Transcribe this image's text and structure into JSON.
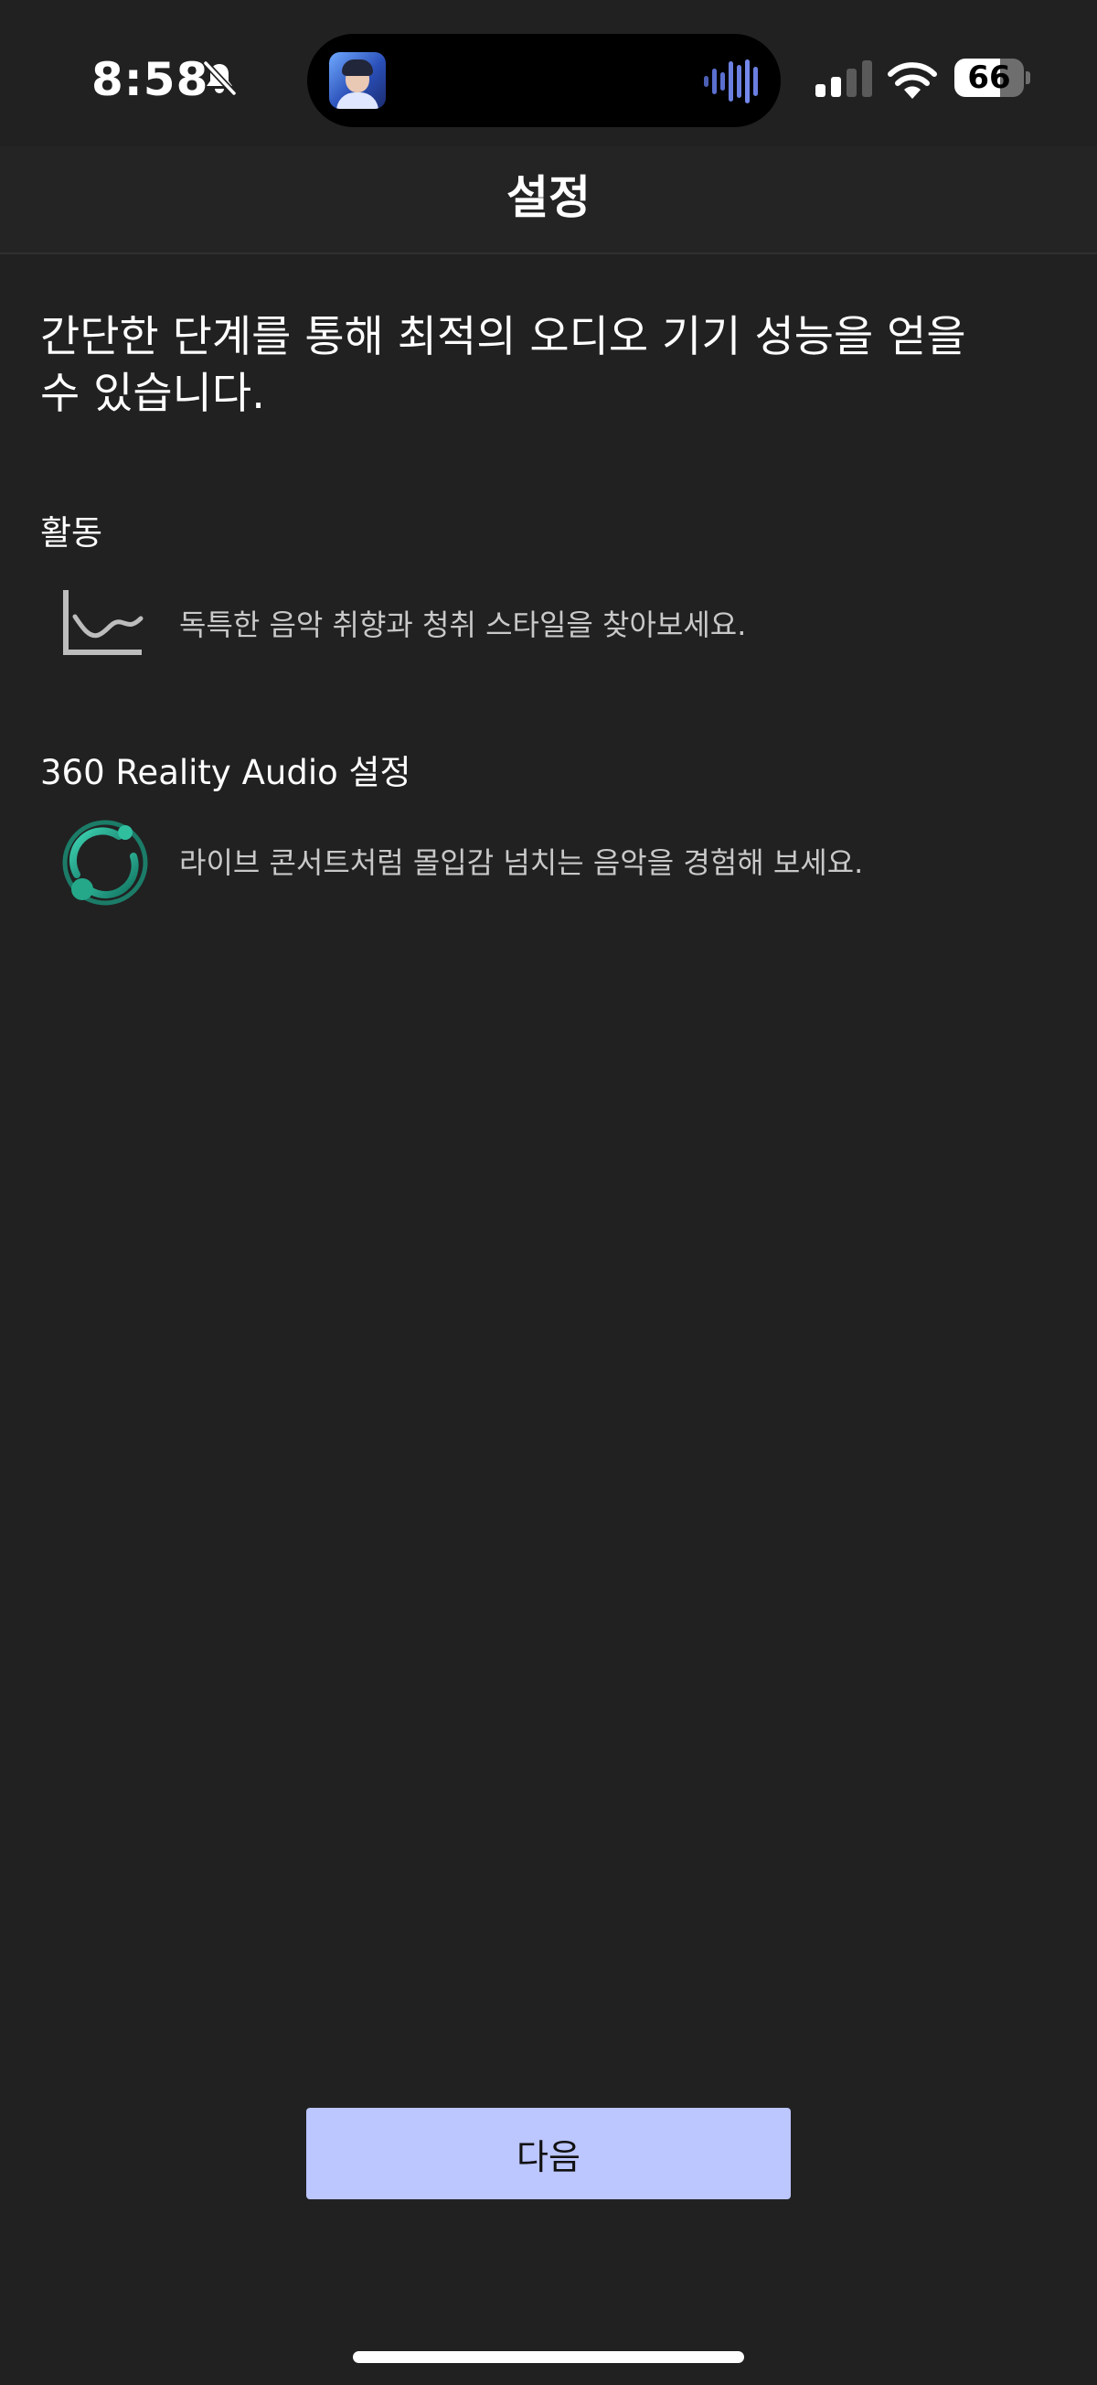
{
  "status_bar": {
    "time": "8:58",
    "battery_level": "66",
    "icons": [
      "bell-slash-icon",
      "app-thumbnail-icon",
      "audio-waveform-icon",
      "cellular-signal-icon",
      "wifi-icon",
      "battery-icon"
    ]
  },
  "header": {
    "title": "설정"
  },
  "main": {
    "intro": "간단한 단계를 통해 최적의 오디오 기기 성능을 얻을 수 있습니다.",
    "sections": [
      {
        "title": "활동",
        "icon": "line-chart-icon",
        "description": "독특한 음악 취향과 청취 스타일을 찾아보세요."
      },
      {
        "title": "360 Reality Audio 설정",
        "icon": "360-reality-audio-icon",
        "description": "라이브 콘서트처럼 몰입감 넘치는 음악을 경험해 보세요."
      }
    ]
  },
  "footer": {
    "next_label": "다음"
  },
  "colors": {
    "background": "#212121",
    "header_background": "#242424",
    "button": "#bcc6ff",
    "teal_accent": "#1f9e85",
    "waveform": "#6a7fe0"
  }
}
